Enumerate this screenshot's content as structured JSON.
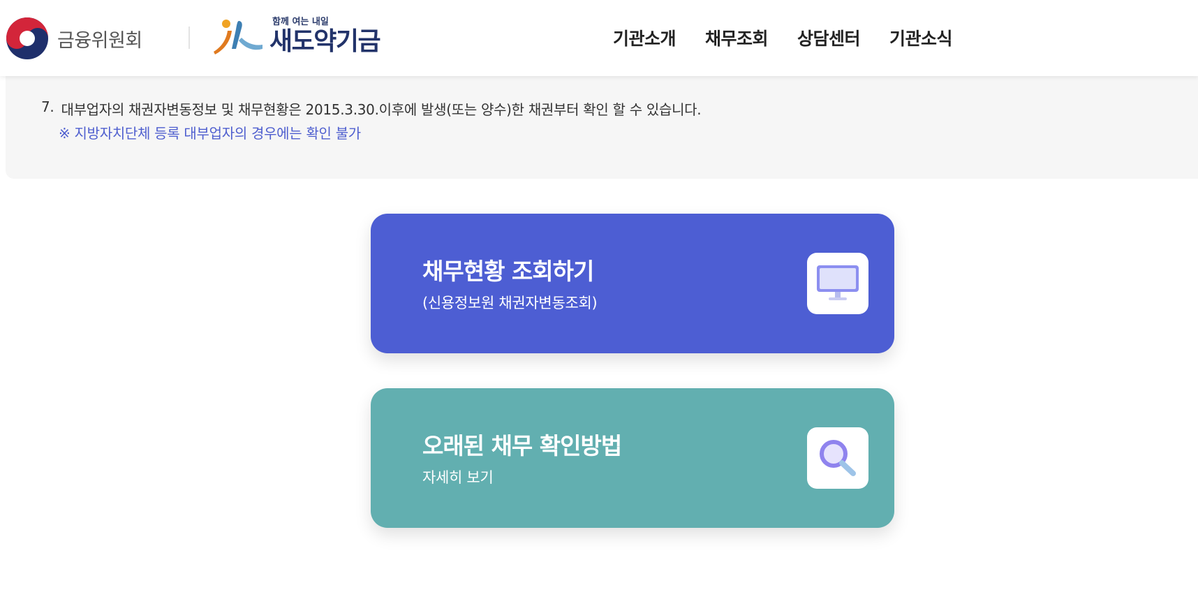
{
  "header": {
    "gov_name": "금융위원회",
    "brand_tagline": "함께 여는 내일",
    "brand_name": "새도약기금",
    "nav": [
      "기관소개",
      "채무조회",
      "상담센터",
      "기관소식"
    ]
  },
  "notice": {
    "number": "7.",
    "text": "대부업자의 채권자변동정보 및 채무현황은 2015.3.30.이후에 발생(또는 양수)한 채권부터 확인 할 수 있습니다.",
    "sub": "※ 지방자치단체 등록 대부업자의 경우에는 확인 불가"
  },
  "cards": [
    {
      "title": "채무현황 조회하기",
      "subtitle": "(신용정보원 채권자변동조회)",
      "icon": "monitor-icon",
      "color": "#4d5ed3"
    },
    {
      "title": "오래된 채무 확인방법",
      "subtitle": "자세히 보기",
      "icon": "magnifier-icon",
      "color": "#62afb0"
    }
  ]
}
